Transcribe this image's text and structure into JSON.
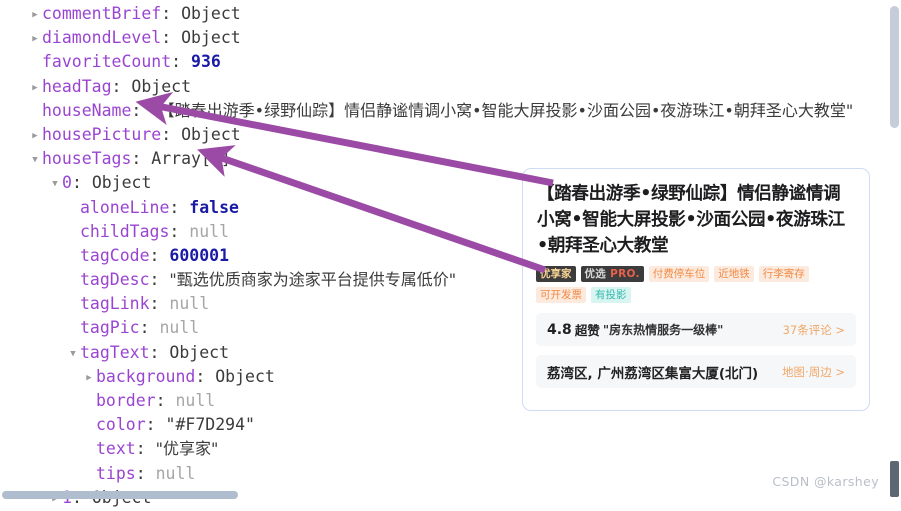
{
  "tree": {
    "rows": [
      {
        "indent": 0,
        "toggle": "closed",
        "key": "commentBrief",
        "valueType": "object",
        "value": "Object"
      },
      {
        "indent": 0,
        "toggle": "closed",
        "key": "diamondLevel",
        "valueType": "object",
        "value": "Object"
      },
      {
        "indent": 0,
        "toggle": "none",
        "key": "favoriteCount",
        "valueType": "number",
        "value": "936"
      },
      {
        "indent": 0,
        "toggle": "closed",
        "key": "headTag",
        "valueType": "object",
        "value": "Object"
      },
      {
        "indent": 0,
        "toggle": "none",
        "key": "houseName",
        "valueType": "string-cjk",
        "value": "\"【踏春出游季•绿野仙踪】情侣静谧情调小窝•智能大屏投影•沙面公园•夜游珠江•朝拜圣心大教堂\""
      },
      {
        "indent": 0,
        "toggle": "closed",
        "key": "housePicture",
        "valueType": "object",
        "value": "Object"
      },
      {
        "indent": 0,
        "toggle": "open",
        "key": "houseTags",
        "valueType": "object",
        "value": "Array[7]"
      },
      {
        "indent": 1,
        "toggle": "open",
        "key": "0",
        "valueType": "object",
        "value": "Object",
        "keyStyle": "index"
      },
      {
        "indent": 2,
        "toggle": "none",
        "key": "aloneLine",
        "valueType": "bool",
        "value": "false"
      },
      {
        "indent": 2,
        "toggle": "none",
        "key": "childTags",
        "valueType": "null",
        "value": "null"
      },
      {
        "indent": 2,
        "toggle": "none",
        "key": "tagCode",
        "valueType": "number",
        "value": "600001"
      },
      {
        "indent": 2,
        "toggle": "none",
        "key": "tagDesc",
        "valueType": "string-cjk",
        "value": "\"甄选优质商家为途家平台提供专属低价\""
      },
      {
        "indent": 2,
        "toggle": "none",
        "key": "tagLink",
        "valueType": "null",
        "value": "null"
      },
      {
        "indent": 2,
        "toggle": "none",
        "key": "tagPic",
        "valueType": "null",
        "value": "null"
      },
      {
        "indent": 2,
        "toggle": "open",
        "key": "tagText",
        "valueType": "object",
        "value": "Object",
        "extraIndent": true
      },
      {
        "indent": 3,
        "toggle": "closed",
        "key": "background",
        "valueType": "object",
        "value": "Object"
      },
      {
        "indent": 3,
        "toggle": "none",
        "key": "border",
        "valueType": "null",
        "value": "null"
      },
      {
        "indent": 3,
        "toggle": "none",
        "key": "color",
        "valueType": "string",
        "value": "\"#F7D294\""
      },
      {
        "indent": 3,
        "toggle": "none",
        "key": "text",
        "valueType": "string-cjk",
        "value": "\"优享家\""
      },
      {
        "indent": 3,
        "toggle": "none",
        "key": "tips",
        "valueType": "null",
        "value": "null"
      },
      {
        "indent": 1,
        "toggle": "closed",
        "key": "1",
        "valueType": "object",
        "value": "Object",
        "keyStyle": "index"
      }
    ]
  },
  "card": {
    "title": "【踏春出游季•绿野仙踪】情侣静谧情调小窝•智能大屏投影•沙面公园•夜游珠江•朝拜圣心大教堂",
    "tags": [
      {
        "text": "优享家",
        "style": "dark-gold"
      },
      {
        "text": "优选",
        "suffix": "PRO.",
        "style": "dark-pro"
      },
      {
        "text": "付费停车位",
        "style": "orange"
      },
      {
        "text": "近地铁",
        "style": "orange"
      },
      {
        "text": "行李寄存",
        "style": "orange"
      },
      {
        "text": "可开发票",
        "style": "orange"
      },
      {
        "text": "有投影",
        "style": "cyan"
      }
    ],
    "review": {
      "score": "4.8",
      "score_word": "超赞",
      "quote": "\"房东热情服务一级棒\"",
      "link": "37条评论 >"
    },
    "location": {
      "address": "荔湾区, 广州荔湾区集富大厦(北门)",
      "link": "地图·周边 >"
    }
  },
  "watermark": "CSDN @karshey",
  "colors": {
    "key": "#9a45d1",
    "number": "#1a1aa6",
    "null": "#a6a6a6",
    "tag_gold": "#F7D294",
    "tag_dark": "#3c3c3c",
    "tag_orange_bg": "#fdeade",
    "tag_orange_fg": "#f08a44",
    "tag_cyan_bg": "#d8f5f2",
    "tag_cyan_fg": "#39b7ae",
    "arrow": "#9b4ba5",
    "card_border": "#cfdcf3"
  }
}
